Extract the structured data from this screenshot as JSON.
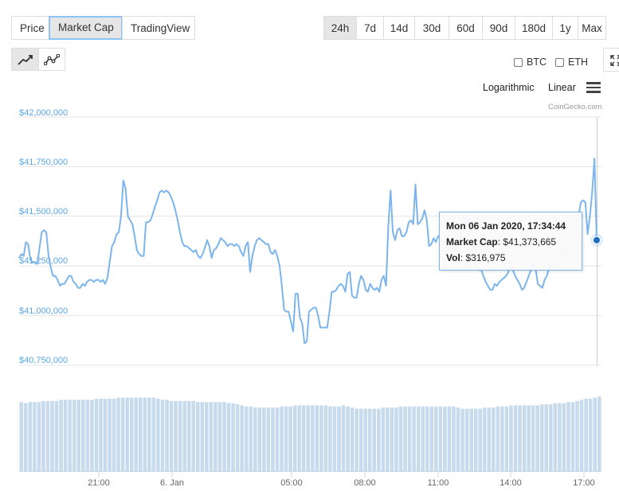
{
  "tabs": {
    "price": "Price",
    "market_cap": "Market Cap",
    "tradingview": "TradingView"
  },
  "ranges": [
    "24h",
    "7d",
    "14d",
    "30d",
    "60d",
    "90d",
    "180d",
    "1y",
    "Max"
  ],
  "active_range": "24h",
  "compare": {
    "btc": "BTC",
    "eth": "ETH"
  },
  "scale": {
    "logarithmic": "Logarithmic",
    "linear": "Linear"
  },
  "credit": "CoinGecko.com",
  "tooltip": {
    "date": "Mon 06 Jan 2020, 17:34:44",
    "cap_label": "Market Cap",
    "cap_value": "$41,373,665",
    "vol_label": "Vol",
    "vol_value": "$316,975"
  },
  "colors": {
    "line": "#7cb5ec",
    "axis_label": "#5aa7e6",
    "marker": "#1f6fbf"
  },
  "chart_data": {
    "type": "line",
    "y_tick_labels": [
      "$42,000,000",
      "$41,750,000",
      "$41,500,000",
      "$41,250,000",
      "$41,000,000",
      "$40,750,000"
    ],
    "x_tick_labels": [
      "21:00",
      "6. Jan",
      "05:00",
      "08:00",
      "11:00",
      "14:00",
      "17:00"
    ],
    "ylim": [
      40750000,
      42000000
    ],
    "grid": true,
    "series": [
      {
        "values": [
          41290000,
          41310000,
          41300000,
          41370000,
          41360000,
          41280000,
          41270000,
          41270000,
          41260000,
          41340000,
          41420000,
          41430000,
          41420000,
          41300000,
          41240000,
          41200000,
          41200000,
          41180000,
          41150000,
          41160000,
          41160000,
          41180000,
          41200000,
          41200000,
          41170000,
          41160000,
          41140000,
          41140000,
          41160000,
          41150000,
          41170000,
          41180000,
          41180000,
          41170000,
          41180000,
          41180000,
          41170000,
          41180000,
          41160000,
          41190000,
          41270000,
          41350000,
          41370000,
          41410000,
          41420000,
          41500000,
          41680000,
          41640000,
          41500000,
          41480000,
          41460000,
          41400000,
          41330000,
          41310000,
          41300000,
          41300000,
          41470000,
          41470000,
          41480000,
          41510000,
          41550000,
          41580000,
          41620000,
          41630000,
          41620000,
          41630000,
          41620000,
          41600000,
          41570000,
          41530000,
          41480000,
          41420000,
          41370000,
          41350000,
          41350000,
          41340000,
          41330000,
          41320000,
          41330000,
          41300000,
          41290000,
          41310000,
          41340000,
          41380000,
          41350000,
          41290000,
          41330000,
          41340000,
          41360000,
          41390000,
          41380000,
          41370000,
          41350000,
          41360000,
          41360000,
          41350000,
          41360000,
          41350000,
          41320000,
          41300000,
          41350000,
          41370000,
          41220000,
          41300000,
          41350000,
          41380000,
          41390000,
          41380000,
          41370000,
          41360000,
          41360000,
          41320000,
          41310000,
          41330000,
          41300000,
          41250000,
          41150000,
          41030000,
          41020000,
          41020000,
          40970000,
          40920000,
          41110000,
          41110000,
          40990000,
          40960000,
          40860000,
          40870000,
          41020000,
          41030000,
          41040000,
          41040000,
          41000000,
          40940000,
          40940000,
          40940000,
          40940000,
          41020000,
          41120000,
          41120000,
          41130000,
          41150000,
          41160000,
          41150000,
          41120000,
          41210000,
          41220000,
          41100000,
          41090000,
          41090000,
          41160000,
          41200000,
          41180000,
          41130000,
          41120000,
          41160000,
          41140000,
          41130000,
          41140000,
          41120000,
          41180000,
          41200000,
          41150000,
          41450000,
          41630000,
          41420000,
          41380000,
          41430000,
          41440000,
          41400000,
          41400000,
          41420000,
          41470000,
          41480000,
          41460000,
          41660000,
          41460000,
          41470000,
          41490000,
          41530000,
          41480000,
          41350000,
          41360000,
          41390000,
          41370000,
          41400000,
          41390000,
          41370000,
          41350000,
          41340000,
          41350000,
          41360000,
          41330000,
          41320000,
          41380000,
          41400000,
          41480000,
          41520000,
          41420000,
          41350000,
          41300000,
          41290000,
          41240000,
          41230000,
          41230000,
          41200000,
          41170000,
          41150000,
          41130000,
          41130000,
          41160000,
          41150000,
          41170000,
          41180000,
          41190000,
          41200000,
          41220000,
          41250000,
          41230000,
          41200000,
          41180000,
          41160000,
          41130000,
          41140000,
          41170000,
          41200000,
          41230000,
          41280000,
          41240000,
          41160000,
          41150000,
          41140000,
          41180000,
          41200000,
          41240000,
          41270000,
          41260000,
          41240000,
          41280000,
          41310000,
          41340000,
          41320000,
          41330000,
          41350000,
          41380000,
          41410000,
          41450000,
          41500000,
          41570000,
          41580000,
          41570000,
          41410000,
          41500000,
          41620000,
          41790000,
          41380000
        ]
      }
    ],
    "volume_bars": [
      0.62,
      0.61,
      0.62,
      0.62,
      0.62,
      0.63,
      0.63,
      0.63,
      0.63,
      0.64,
      0.64,
      0.64,
      0.64,
      0.64,
      0.64,
      0.64,
      0.64,
      0.65,
      0.65,
      0.65,
      0.65,
      0.65,
      0.66,
      0.66,
      0.66,
      0.66,
      0.66,
      0.66,
      0.66,
      0.66,
      0.66,
      0.65,
      0.64,
      0.64,
      0.63,
      0.63,
      0.63,
      0.63,
      0.63,
      0.63,
      0.62,
      0.62,
      0.62,
      0.62,
      0.62,
      0.62,
      0.62,
      0.61,
      0.61,
      0.6,
      0.59,
      0.58,
      0.58,
      0.57,
      0.57,
      0.57,
      0.57,
      0.57,
      0.57,
      0.58,
      0.58,
      0.58,
      0.59,
      0.59,
      0.59,
      0.59,
      0.59,
      0.59,
      0.59,
      0.59,
      0.58,
      0.58,
      0.58,
      0.59,
      0.58,
      0.57,
      0.56,
      0.56,
      0.56,
      0.56,
      0.56,
      0.56,
      0.57,
      0.57,
      0.57,
      0.57,
      0.58,
      0.58,
      0.58,
      0.58,
      0.58,
      0.58,
      0.58,
      0.58,
      0.58,
      0.58,
      0.58,
      0.58,
      0.58,
      0.57,
      0.56,
      0.56,
      0.56,
      0.56,
      0.56,
      0.57,
      0.57,
      0.57,
      0.58,
      0.58,
      0.58,
      0.59,
      0.59,
      0.59,
      0.59,
      0.59,
      0.59,
      0.59,
      0.6,
      0.6,
      0.6,
      0.61,
      0.61,
      0.61,
      0.62,
      0.62,
      0.63,
      0.64,
      0.65,
      0.65,
      0.66,
      0.67
    ]
  }
}
